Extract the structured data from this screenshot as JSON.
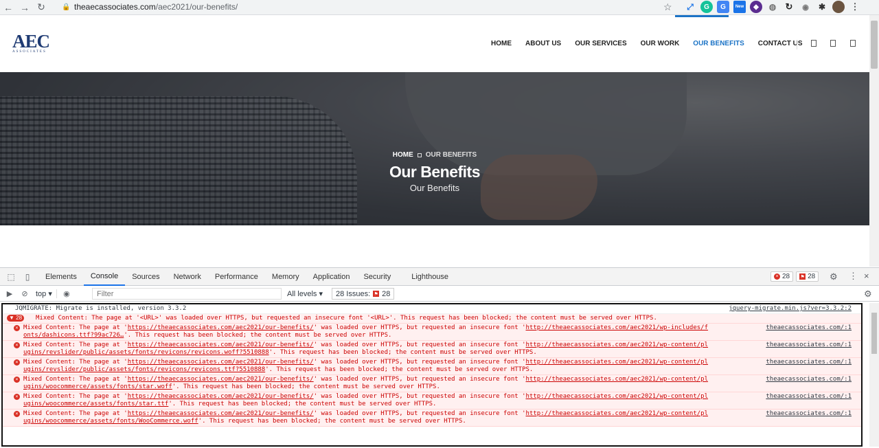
{
  "browser": {
    "url_host": "theaecassociates.com",
    "url_path": "/aec2021/our-benefits/",
    "ext_new_label": "New"
  },
  "site": {
    "logo_main": "AEC",
    "logo_sub": "ASSOCIATES",
    "nav": [
      {
        "label": "HOME"
      },
      {
        "label": "ABOUT US"
      },
      {
        "label": "OUR SERVICES"
      },
      {
        "label": "OUR WORK"
      },
      {
        "label": "OUR BENEFITS"
      },
      {
        "label": "CONTACT US"
      }
    ]
  },
  "hero": {
    "breadcrumb_home": "HOME",
    "breadcrumb_current": "OUR BENEFITS",
    "title": "Our Benefits",
    "subtitle": "Our Benefits"
  },
  "devtools": {
    "tabs": [
      "Elements",
      "Console",
      "Sources",
      "Network",
      "Performance",
      "Memory",
      "Application",
      "Security",
      "Lighthouse"
    ],
    "active_tab": "Console",
    "error_count": "28",
    "issue_count": "28",
    "context": "top",
    "filter_placeholder": "Filter",
    "levels": "All levels",
    "issues_label": "28 Issues:",
    "issues_count": "28",
    "accent_color": "#1a73e8",
    "error_color": "#d93025",
    "logs": {
      "info_text": "JQMIGRATE: Migrate is installed, version 3.3.2",
      "info_src": "jquery-migrate.min.js?ver=3.3.2:2",
      "group_count": "28",
      "group_text": "Mixed Content: The page at '<URL>' was loaded over HTTPS, but requested an insecure font '<URL>'. This request has been blocked; the content must be served over HTTPS.",
      "e1_l1a": "Mixed Content: The page at '",
      "page_url": "https://theaecassociates.com/aec2021/our-benefits/",
      "e1_l1b": "' was loaded over HTTPS, but requested an insecure font '",
      "e1_font_a": "http://theaecassociates.com/aec2021/wp-includes/f",
      "e1_font_b": "onts/dashicons.ttf?99ac726…",
      "e1_tail": "'. This request has been blocked; the content must be served over HTTPS.",
      "src_short": "theaecassociates.com/:1",
      "e2_font_a": "http://theaecassociates.com/aec2021/wp-content/pl",
      "e2_font_b": "ugins/revslider/public/assets/fonts/revicons/revicons.woff?5510888",
      "e3_font_b": "ugins/revslider/public/assets/fonts/revicons/revicons.ttf?5510888",
      "e4_font_b": "ugins/woocommerce/assets/fonts/star.woff",
      "e5_font_b": "ugins/woocommerce/assets/fonts/star.ttf",
      "e6_font_b": "ugins/woocommerce/assets/fonts/WooCommerce.woff"
    }
  }
}
